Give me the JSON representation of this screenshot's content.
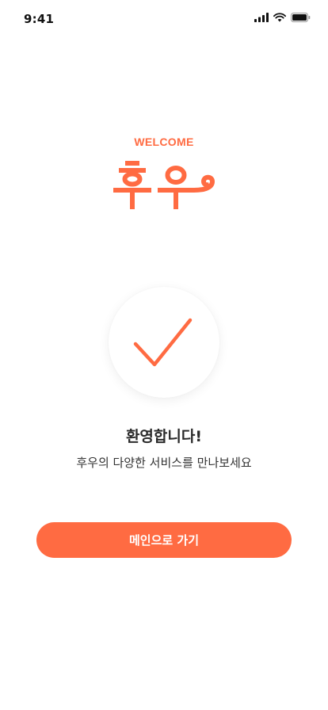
{
  "status_bar": {
    "time": "9:41",
    "icons": [
      "signal-icon",
      "wifi-icon",
      "battery-icon"
    ]
  },
  "welcome": {
    "label": "WELCOME",
    "logo_text": "후우",
    "title": "환영합니다!",
    "subtitle": "후우의 다양한 서비스를 만나보세요"
  },
  "success_icon": "checkmark-icon",
  "actions": {
    "go_main_label": "메인으로 가기"
  },
  "colors": {
    "accent": "#FF6B42",
    "text": "#222222",
    "background": "#FFFFFF"
  }
}
